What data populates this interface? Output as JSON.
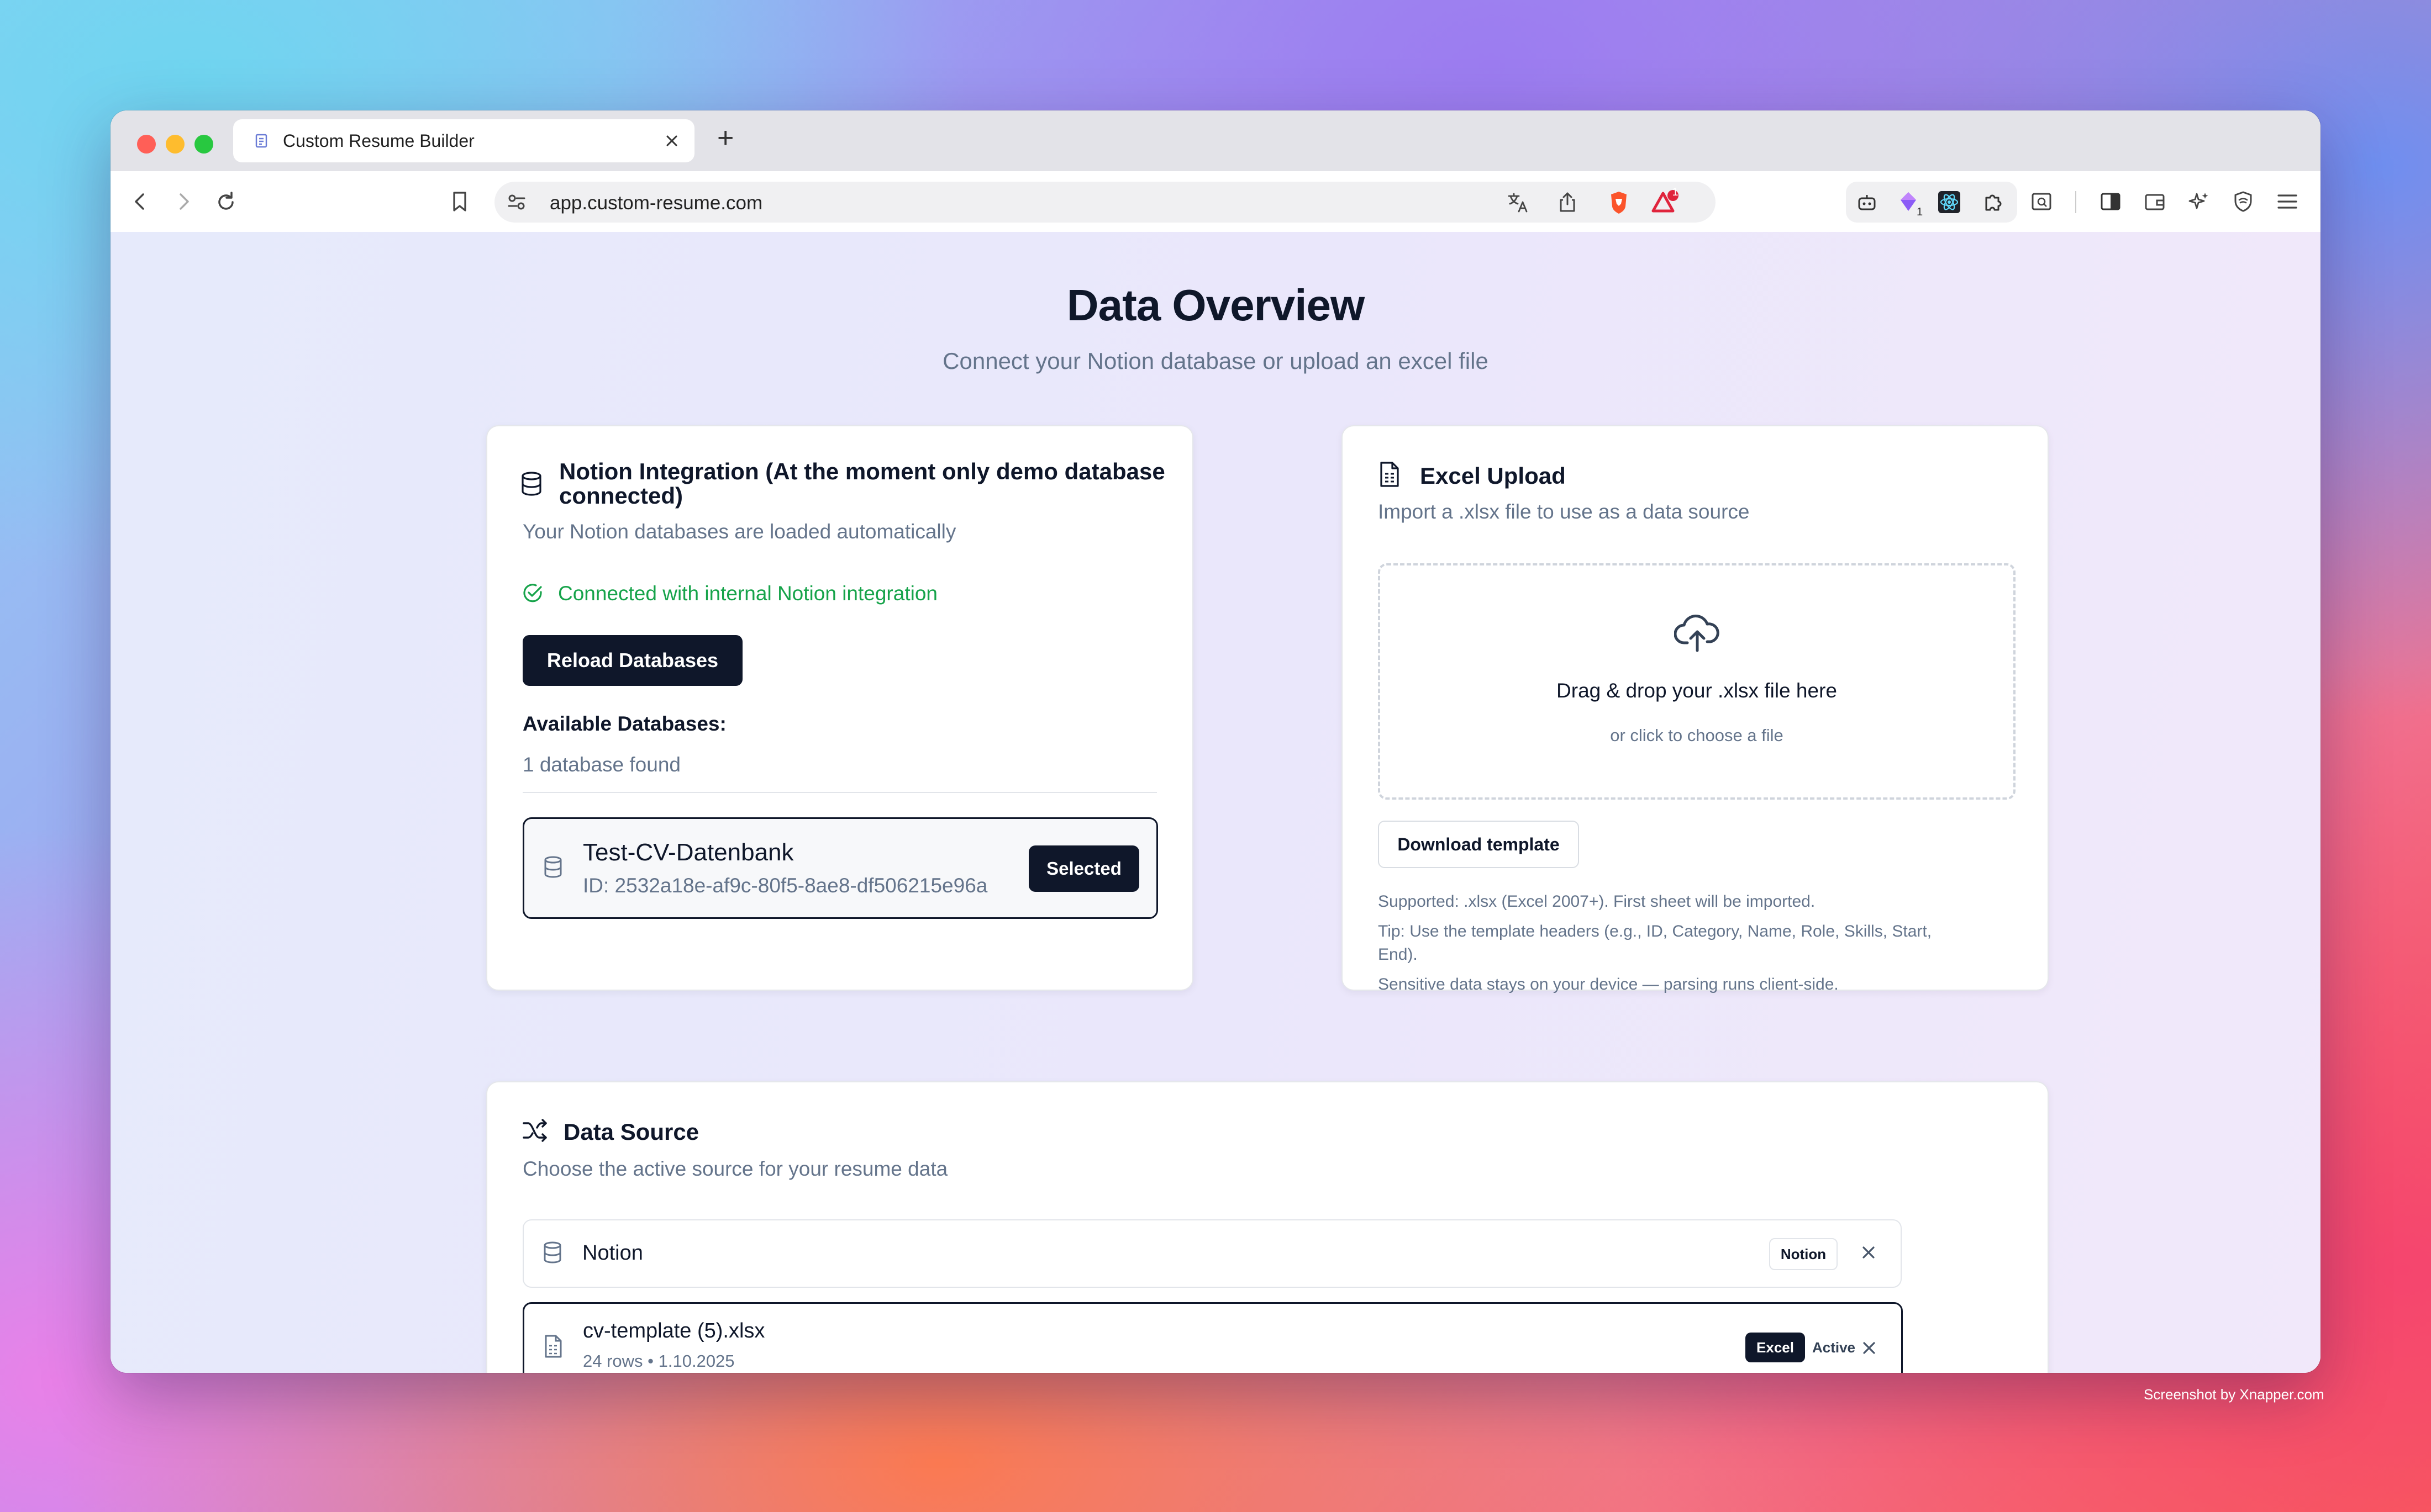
{
  "browser": {
    "tab_title": "Custom Resume Builder",
    "new_tab_symbol": "+",
    "url": "app.custom-resume.com",
    "notification_count": "1",
    "extension_count": "1"
  },
  "page": {
    "title": "Data Overview",
    "subtitle": "Connect your Notion database or upload an excel file"
  },
  "notion_card": {
    "title": "Notion Integration (At the moment only demo database connected)",
    "description": "Your Notion databases are loaded automatically",
    "status": "Connected with internal Notion integration",
    "reload_button": "Reload Databases",
    "available_label": "Available Databases:",
    "count_text": "1 database found",
    "database": {
      "name": "Test-CV-Datenbank",
      "id_text": "ID: 2532a18e-af9c-80f5-8ae8-df506215e96a",
      "selected_label": "Selected"
    }
  },
  "excel_card": {
    "title": "Excel Upload",
    "description": "Import a .xlsx file to use as a data source",
    "drop_title": "Drag & drop your .xlsx file here",
    "drop_sub": "or click to choose a file",
    "download_button": "Download template",
    "note1": "Supported: .xlsx (Excel 2007+). First sheet will be imported.",
    "note2a": "Tip: Use the template headers (e.g., ID, Category, Name, Role, Skills, Start,",
    "note2b": "End).",
    "note3": "Sensitive data stays on your device — parsing runs client-side."
  },
  "data_source_card": {
    "title": "Data Source",
    "description": "Choose the active source for your resume data",
    "sources": [
      {
        "name": "Notion",
        "badge": "Notion"
      },
      {
        "name": "cv-template (5).xlsx",
        "meta": "24 rows • 1.10.2025",
        "badge": "Excel",
        "status": "Active"
      }
    ]
  },
  "watermark": "Screenshot by Xnapper.com",
  "colors": {
    "primary_dark": "#0f172a",
    "success_green": "#16a34a",
    "muted_text": "#64748b",
    "close_red": "#ff5f57",
    "minimize_yellow": "#febc2e",
    "zoom_green": "#28c840"
  }
}
